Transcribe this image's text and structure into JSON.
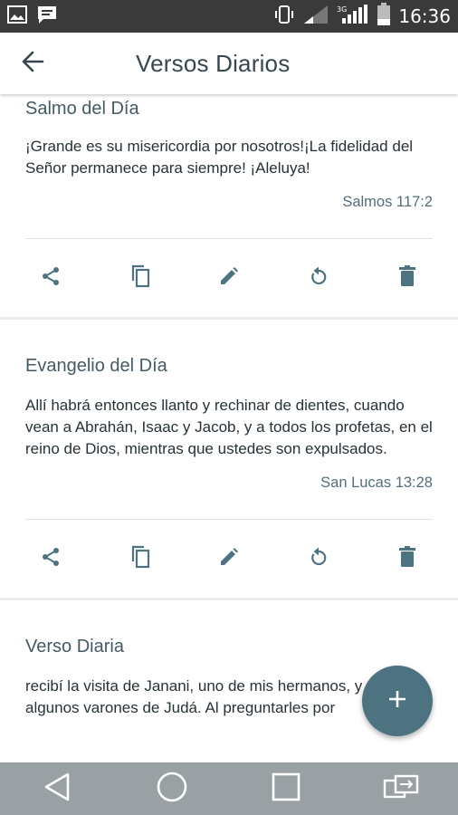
{
  "status_bar": {
    "time": "16:36",
    "icons": [
      "image-icon",
      "message-icon",
      "vibrate-icon",
      "signal-icon",
      "signal-3g-icon",
      "battery-icon"
    ]
  },
  "app_bar": {
    "title": "Versos Diarios",
    "back_icon": "arrow-back-icon"
  },
  "cards": [
    {
      "title": "Salmo del Día",
      "text": "¡Grande es su misericordia por nosotros!¡La fidelidad del Señor permanece para siempre! ¡Aleluya!",
      "reference": "Salmos 117:2"
    },
    {
      "title": "Evangelio del Día",
      "text": "Allí habrá entonces llanto y rechinar de dientes, cuando vean a Abrahán, Isaac y Jacob, y a todos los profetas, en el reino de Dios, mientras que ustedes son expulsados.",
      "reference": "San Lucas 13:28"
    },
    {
      "title": "Verso Diaria",
      "text": "recibí la visita de Janani, uno de mis hermanos, y de algunos varones de Judá. Al preguntarles por"
    }
  ],
  "card_actions": [
    "share-icon",
    "copy-icon",
    "edit-icon",
    "refresh-icon",
    "delete-icon"
  ],
  "fab": {
    "icon": "add-icon"
  },
  "nav_bar": {
    "icons": [
      "back-triangle-icon",
      "home-circle-icon",
      "recents-square-icon",
      "screen-switch-icon"
    ]
  },
  "colors": {
    "status_bar": "#3a3a3a",
    "accent_icon": "#4d7380",
    "fab": "#4d7380",
    "nav_bar": "#9aa1a4",
    "title_text": "#37474f"
  }
}
